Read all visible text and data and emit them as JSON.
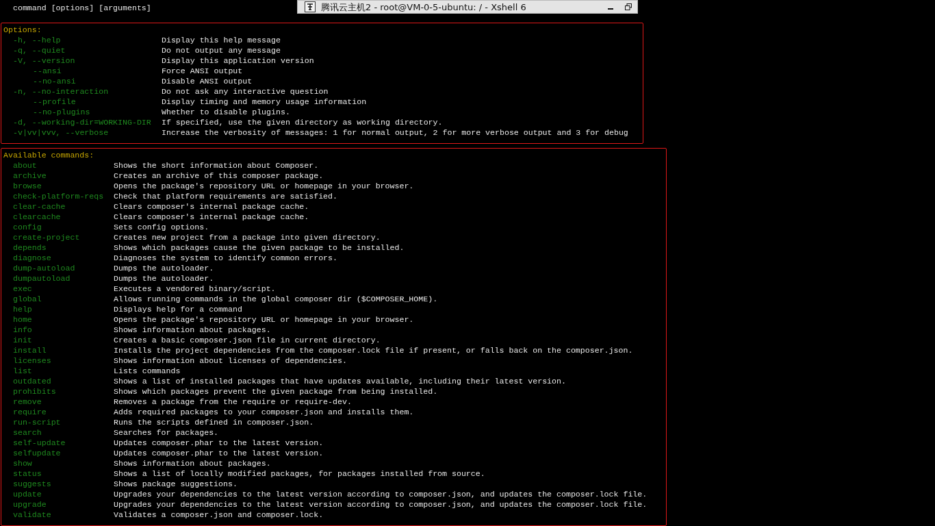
{
  "prompt_line": "command [options] [arguments]",
  "window": {
    "title": "腾讯云主机2 - root@VM-0-5-ubuntu: / - Xshell 6"
  },
  "options": {
    "heading": "Options:",
    "rows": [
      {
        "name": "-h, --help",
        "indented": false,
        "description": "Display this help message"
      },
      {
        "name": "-q, --quiet",
        "indented": false,
        "description": "Do not output any message"
      },
      {
        "name": "-V, --version",
        "indented": false,
        "description": "Display this application version"
      },
      {
        "name": "--ansi",
        "indented": true,
        "description": "Force ANSI output"
      },
      {
        "name": "--no-ansi",
        "indented": true,
        "description": "Disable ANSI output"
      },
      {
        "name": "-n, --no-interaction",
        "indented": false,
        "description": "Do not ask any interactive question"
      },
      {
        "name": "--profile",
        "indented": true,
        "description": "Display timing and memory usage information"
      },
      {
        "name": "--no-plugins",
        "indented": true,
        "description": "Whether to disable plugins."
      },
      {
        "name": "-d, --working-dir=WORKING-DIR",
        "indented": false,
        "description": "If specified, use the given directory as working directory."
      },
      {
        "name": "-v|vv|vvv, --verbose",
        "indented": false,
        "description": "Increase the verbosity of messages: 1 for normal output, 2 for more verbose output and 3 for debug"
      }
    ]
  },
  "commands": {
    "heading": "Available commands:",
    "rows": [
      {
        "name": "about",
        "description": "Shows the short information about Composer."
      },
      {
        "name": "archive",
        "description": "Creates an archive of this composer package."
      },
      {
        "name": "browse",
        "description": "Opens the package's repository URL or homepage in your browser."
      },
      {
        "name": "check-platform-reqs",
        "description": "Check that platform requirements are satisfied."
      },
      {
        "name": "clear-cache",
        "description": "Clears composer's internal package cache."
      },
      {
        "name": "clearcache",
        "description": "Clears composer's internal package cache."
      },
      {
        "name": "config",
        "description": "Sets config options."
      },
      {
        "name": "create-project",
        "description": "Creates new project from a package into given directory."
      },
      {
        "name": "depends",
        "description": "Shows which packages cause the given package to be installed."
      },
      {
        "name": "diagnose",
        "description": "Diagnoses the system to identify common errors."
      },
      {
        "name": "dump-autoload",
        "description": "Dumps the autoloader."
      },
      {
        "name": "dumpautoload",
        "description": "Dumps the autoloader."
      },
      {
        "name": "exec",
        "description": "Executes a vendored binary/script."
      },
      {
        "name": "global",
        "description": "Allows running commands in the global composer dir ($COMPOSER_HOME)."
      },
      {
        "name": "help",
        "description": "Displays help for a command"
      },
      {
        "name": "home",
        "description": "Opens the package's repository URL or homepage in your browser."
      },
      {
        "name": "info",
        "description": "Shows information about packages."
      },
      {
        "name": "init",
        "description": "Creates a basic composer.json file in current directory."
      },
      {
        "name": "install",
        "description": "Installs the project dependencies from the composer.lock file if present, or falls back on the composer.json."
      },
      {
        "name": "licenses",
        "description": "Shows information about licenses of dependencies."
      },
      {
        "name": "list",
        "description": "Lists commands"
      },
      {
        "name": "outdated",
        "description": "Shows a list of installed packages that have updates available, including their latest version."
      },
      {
        "name": "prohibits",
        "description": "Shows which packages prevent the given package from being installed."
      },
      {
        "name": "remove",
        "description": "Removes a package from the require or require-dev."
      },
      {
        "name": "require",
        "description": "Adds required packages to your composer.json and installs them."
      },
      {
        "name": "run-script",
        "description": "Runs the scripts defined in composer.json."
      },
      {
        "name": "search",
        "description": "Searches for packages."
      },
      {
        "name": "self-update",
        "description": "Updates composer.phar to the latest version."
      },
      {
        "name": "selfupdate",
        "description": "Updates composer.phar to the latest version."
      },
      {
        "name": "show",
        "description": "Shows information about packages."
      },
      {
        "name": "status",
        "description": "Shows a list of locally modified packages, for packages installed from source."
      },
      {
        "name": "suggests",
        "description": "Shows package suggestions."
      },
      {
        "name": "update",
        "description": "Upgrades your dependencies to the latest version according to composer.json, and updates the composer.lock file."
      },
      {
        "name": "upgrade",
        "description": "Upgrades your dependencies to the latest version according to composer.json, and updates the composer.lock file."
      },
      {
        "name": "validate",
        "description": "Validates a composer.json and composer.lock."
      }
    ]
  }
}
